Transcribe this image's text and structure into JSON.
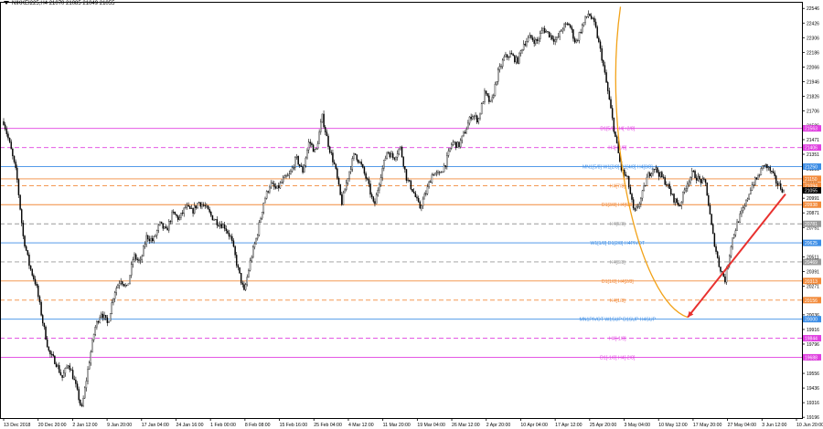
{
  "chart_header": {
    "symbol_line": "NIKKEI225,H4  21070 21085 21049 21055"
  },
  "colors": {
    "candle": "#000000",
    "background": "#ffffff",
    "murrey_blue": "#3c8de6",
    "murrey_magenta": "#e040e0",
    "murrey_orange": "#f28a3a",
    "murrey_gray": "#9a9a9a",
    "curve": "#f2a218",
    "arrow": "#e8312f"
  },
  "chart_data": {
    "type": "candlestick",
    "title": "NIKKEI225,H4",
    "ohlc_readout": {
      "open": 21070,
      "high": 21085,
      "low": 21049,
      "close": 21055
    },
    "ylim": [
      19190,
      22600
    ],
    "y_ticks": [
      22546,
      22426,
      22306,
      22186,
      22066,
      21946,
      21826,
      21706,
      21586,
      21471,
      21351,
      21231,
      21111,
      20991,
      20871,
      20751,
      20631,
      20511,
      20391,
      20271,
      20156,
      20036,
      19916,
      19796,
      19676,
      19556,
      19436,
      19316,
      19196
    ],
    "x_labels": [
      "13 Dec 2018",
      "20 Dec 20:00",
      "2 Jan 12:00",
      "9 Jan 20:00",
      "17 Jan 04:00",
      "24 Jan 16:00",
      "1 Feb 00:00",
      "8 Feb 08:00",
      "15 Feb 16:00",
      "25 Feb 04:00",
      "4 Mar 12:00",
      "11 Mar 20:00",
      "19 Mar 04:00",
      "26 Mar 12:00",
      "2 Apr 20:00",
      "10 Apr 04:00",
      "17 Apr 12:00",
      "25 Apr 20:00",
      "3 May 04:00",
      "10 May 12:00",
      "17 May 20:00",
      "27 May 04:00",
      "3 Jun 12:00",
      "10 Jun 20:00"
    ],
    "price_path": [
      21620,
      21420,
      21180,
      20680,
      20430,
      20280,
      19980,
      19720,
      19650,
      19520,
      19640,
      19470,
      19260,
      19600,
      19920,
      20060,
      19960,
      20220,
      20330,
      20250,
      20520,
      20460,
      20680,
      20640,
      20780,
      20720,
      20870,
      20820,
      20920,
      20880,
      20960,
      20920,
      20840,
      20790,
      20760,
      20660,
      20420,
      20220,
      20490,
      20690,
      20960,
      21110,
      21060,
      21140,
      21180,
      21320,
      21210,
      21460,
      21360,
      21660,
      21420,
      21240,
      20950,
      21180,
      21360,
      21260,
      21120,
      20920,
      21180,
      21380,
      21320,
      21410,
      21150,
      21050,
      20910,
      21040,
      21200,
      21180,
      21280,
      21450,
      21420,
      21540,
      21680,
      21630,
      21850,
      21760,
      22010,
      22140,
      22170,
      22110,
      22260,
      22310,
      22270,
      22380,
      22330,
      22280,
      22390,
      22420,
      22260,
      22400,
      22510,
      22400,
      22150,
      21850,
      21520,
      21230,
      21140,
      20860,
      20980,
      21160,
      21250,
      21180,
      21110,
      20990,
      20930,
      21100,
      21200,
      21140,
      21110,
      20720,
      20450,
      20320,
      20640,
      20810,
      20920,
      21090,
      21160,
      21270,
      21210,
      21110,
      21055
    ],
    "price_path_start_label": "13 Dec 2018",
    "price_path_end_label": "10 Jun 20:00",
    "levels": [
      {
        "label": "D1[5/8] H4[+2/8]",
        "value": 21563,
        "badge": "21563",
        "color": "#e040e0",
        "style": "solid",
        "label_pos": 0.77
      },
      {
        "label": "H4[+1/8]",
        "value": 21406,
        "badge": "21406",
        "color": "#e040e0",
        "style": "dashed",
        "label_pos": 0.77
      },
      {
        "label": "MN1[5/8] W1[2/8] D1[4/8] H4[8/8]",
        "value": 21250,
        "badge": "21250",
        "color": "#3c8de6",
        "style": "solid",
        "label_pos": 0.77
      },
      {
        "label": "",
        "value": 21150,
        "badge": "21150",
        "color": "#f28a3a",
        "style": "solid",
        "label_pos": 0.77
      },
      {
        "label": "H4[7/8]",
        "value": 21094,
        "badge": "21094",
        "color": "#f28a3a",
        "style": "dashed",
        "label_pos": 0.77
      },
      {
        "label": "",
        "value": 21055,
        "badge": "21055",
        "color": "#000000",
        "style": "none",
        "label_pos": 0.77
      },
      {
        "label": "D1[3/8] H4[6/8]",
        "value": 20938,
        "badge": "20938",
        "color": "#f28a3a",
        "style": "solid",
        "label_pos": 0.77
      },
      {
        "label": "H4[5/8]",
        "value": 20781,
        "badge": "20781",
        "color": "#9a9a9a",
        "style": "dashed",
        "label_pos": 0.77
      },
      {
        "label": "W1[1/8] D1[2/8] H4PIVOT",
        "value": 20625,
        "badge": "20625",
        "color": "#3c8de6",
        "style": "solid",
        "label_pos": 0.77
      },
      {
        "label": "H4[3/8]",
        "value": 20469,
        "badge": "20469",
        "color": "#9a9a9a",
        "style": "dashed",
        "label_pos": 0.77
      },
      {
        "label": "D1[1/8] H4[2/8]",
        "value": 20313,
        "badge": "20313",
        "color": "#f28a3a",
        "style": "solid",
        "label_pos": 0.77
      },
      {
        "label": "H4[1/8]",
        "value": 20156,
        "badge": "20156",
        "color": "#f28a3a",
        "style": "dashed",
        "label_pos": 0.77
      },
      {
        "label": "MN1PIVOT W1SUP D1SUP H4SUP",
        "value": 20000,
        "badge": "20000",
        "color": "#3c8de6",
        "style": "solid",
        "label_pos": 0.77
      },
      {
        "label": "H4[-1/8]",
        "value": 19844,
        "badge": "19844",
        "color": "#e040e0",
        "style": "dashed",
        "label_pos": 0.77
      },
      {
        "label": "D1[-1/8] H4[-2/8]",
        "value": 19688,
        "badge": "19688",
        "color": "#e040e0",
        "style": "solid",
        "label_pos": 0.77
      }
    ],
    "drawings": {
      "curve": {
        "from": {
          "x_label": "3 May 04:00",
          "value": 22560
        },
        "to": {
          "value": 20000
        }
      },
      "arrow": {
        "from_value": 21055,
        "to_value": 20000
      }
    }
  }
}
